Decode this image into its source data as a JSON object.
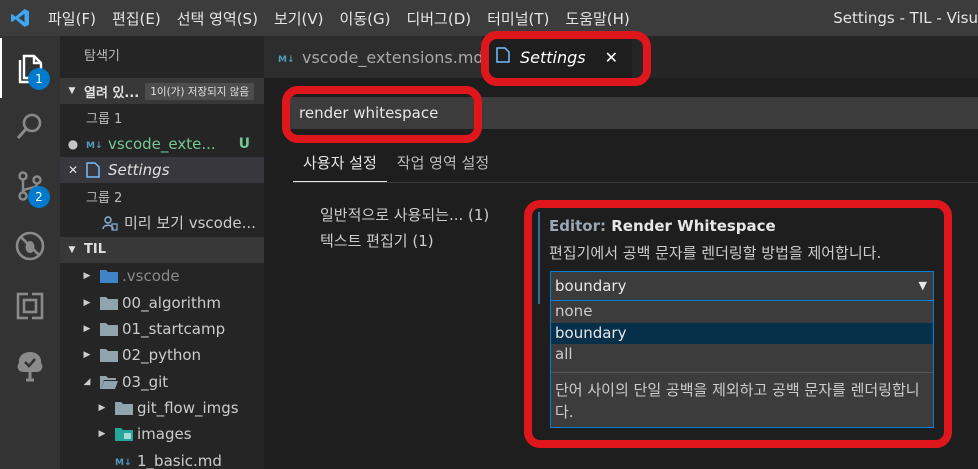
{
  "menu": [
    "파일(F)",
    "편집(E)",
    "선택 영역(S)",
    "보기(V)",
    "이동(G)",
    "디버그(D)",
    "터미널(T)",
    "도움말(H)"
  ],
  "window_title": "Settings - TIL - Visu",
  "activity": {
    "explorer_badge": "1",
    "scm_badge": "2"
  },
  "sidebar": {
    "title": "탐색기",
    "open_editors": {
      "label": "열려 있...",
      "dirty_badge": "1이(가) 저장되지 않음"
    },
    "group1": "그룹 1",
    "open_file_1": "vscode_exte...",
    "open_file_1_status": "U",
    "open_file_2": "Settings",
    "group2": "그룹 2",
    "preview_file": "미리 보기 vscode...",
    "folder_title": "TIL",
    "tree": [
      ".vscode",
      "00_algorithm",
      "01_startcamp",
      "02_python",
      "03_git",
      "git_flow_imgs",
      "images",
      "1_basic.md"
    ]
  },
  "tabs": {
    "file_tab": "vscode_extensions.md",
    "settings_tab": "Settings",
    "close_glyph": "✕"
  },
  "search": {
    "value": "render whitespace"
  },
  "settings_tabs": {
    "user": "사용자 설정",
    "workspace": "작업 영역 설정"
  },
  "toc": [
    "일반적으로 사용되는... (1)",
    "텍스트 편집기 (1)"
  ],
  "setting": {
    "category": "Editor: ",
    "name": "Render Whitespace",
    "description": "편집기에서 공백 문자를 렌더링할 방법을 제어합니다.",
    "selected": "boundary",
    "options": [
      "none",
      "boundary",
      "all"
    ],
    "option_description": "단어 사이의 단일 공백을 제외하고 공백 문자를 렌더링합니다."
  },
  "colors": {
    "accent": "#007acc",
    "highlight": "#e0161d",
    "untracked": "#73c991"
  }
}
